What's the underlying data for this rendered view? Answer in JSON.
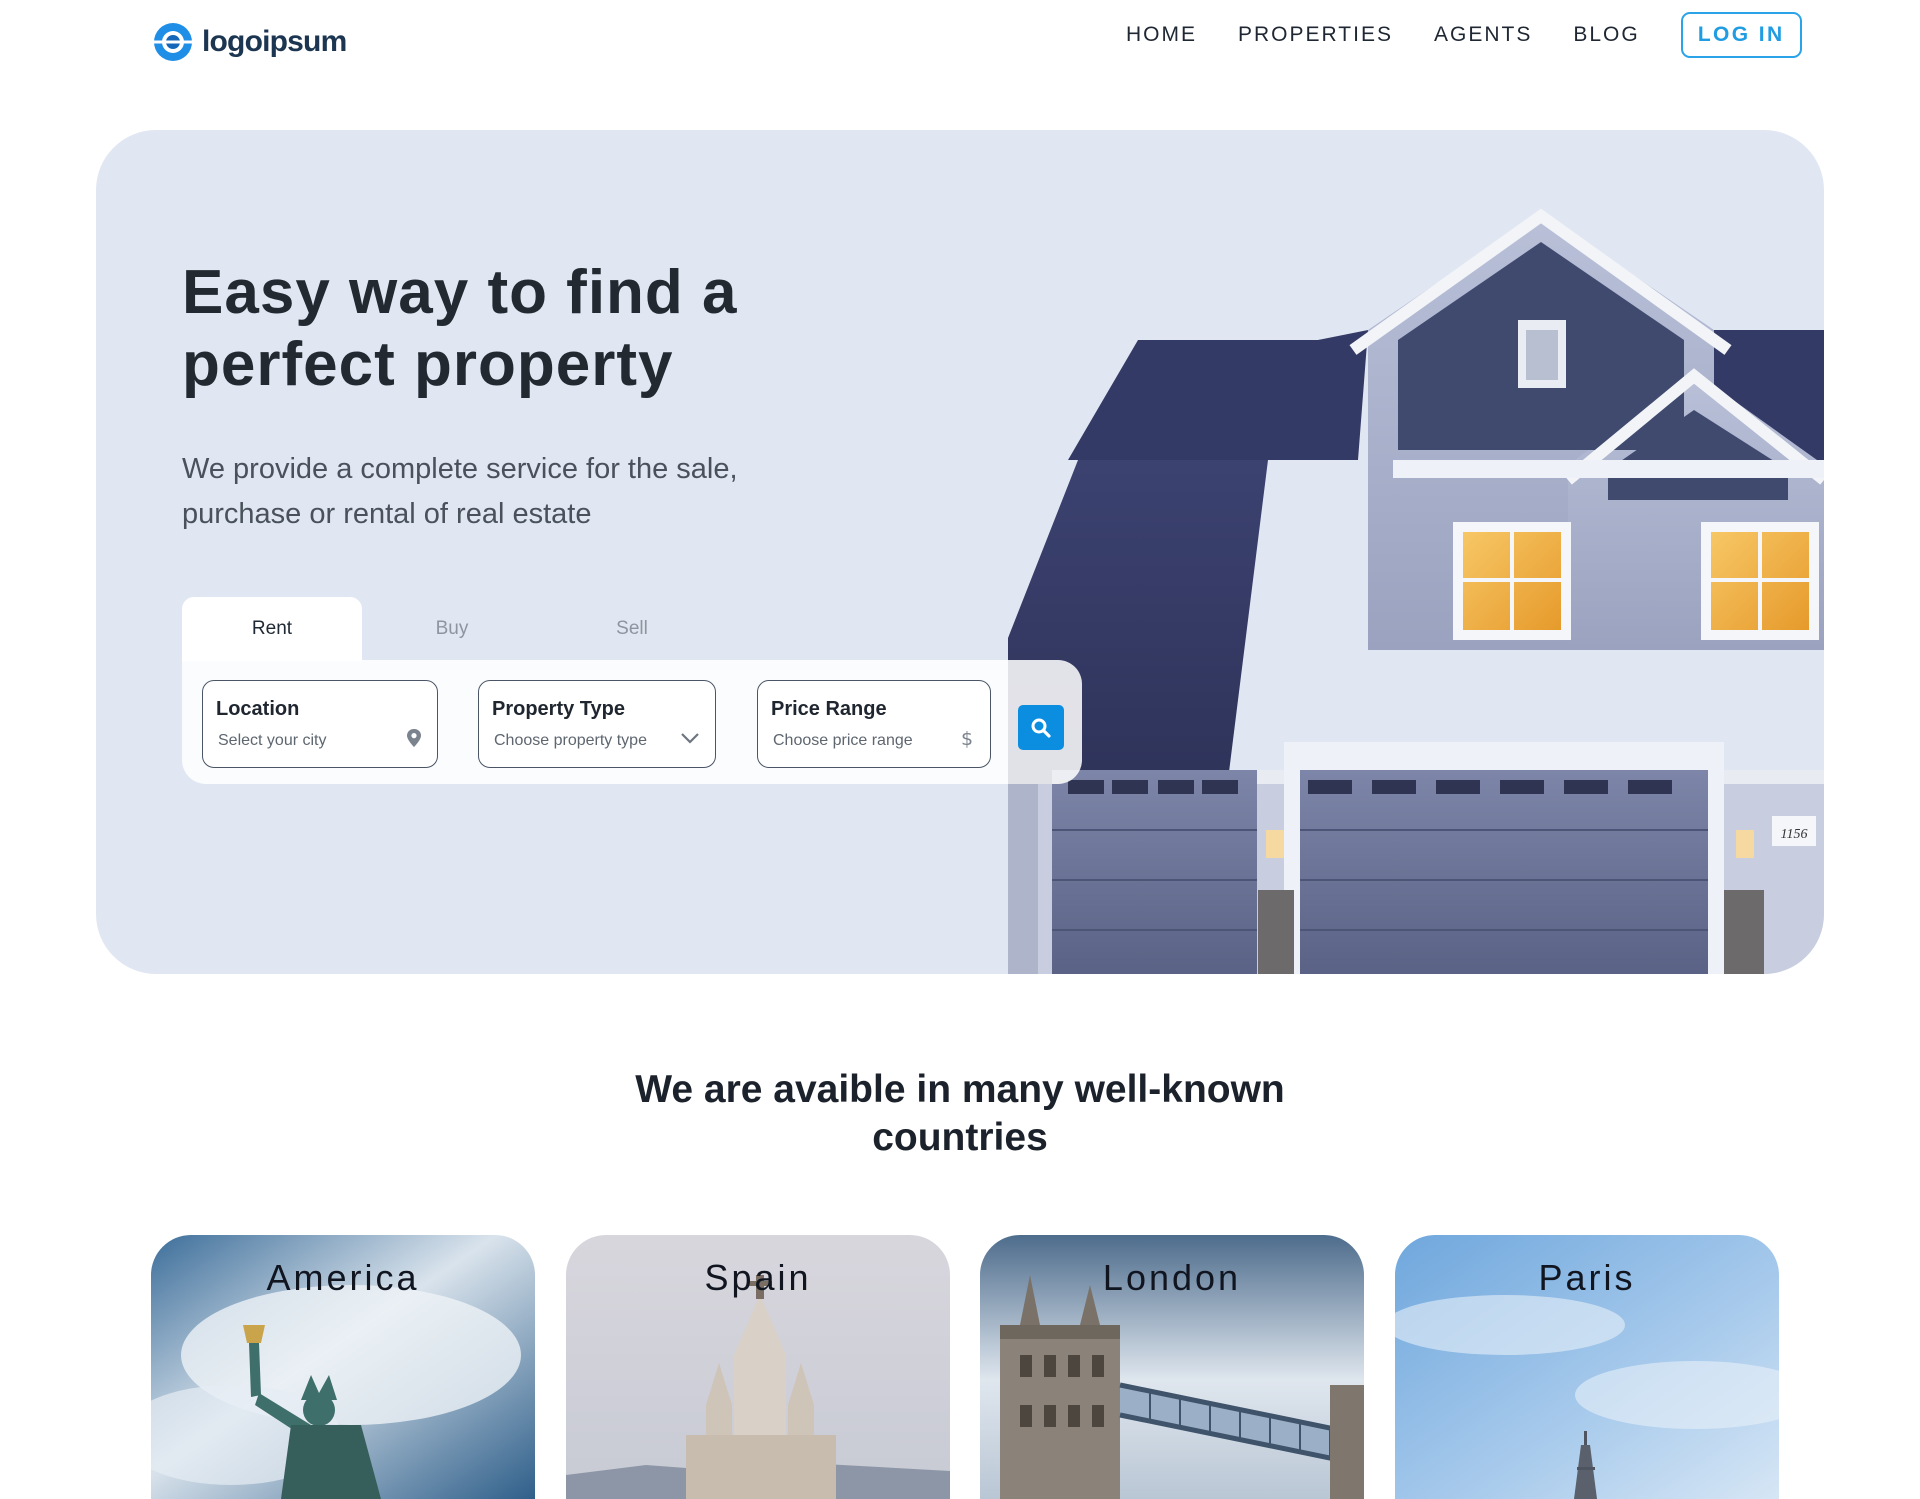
{
  "brand": {
    "name": "logoipsum",
    "accent": "#2a9ff0"
  },
  "nav": {
    "items": [
      {
        "label": "HOME"
      },
      {
        "label": "PROPERTIES"
      },
      {
        "label": "AGENTS"
      },
      {
        "label": "BLOG"
      }
    ],
    "login_label": "LOG IN"
  },
  "hero": {
    "title": "Easy way to find a perfect property",
    "subtitle": "We provide a complete service for the sale, purchase or rental of real estate",
    "house_number": "1156"
  },
  "search": {
    "tabs": [
      {
        "label": "Rent",
        "active": true
      },
      {
        "label": "Buy",
        "active": false
      },
      {
        "label": "Sell",
        "active": false
      }
    ],
    "fields": {
      "location": {
        "label": "Location",
        "placeholder": "Select your city",
        "icon": "map-pin-icon"
      },
      "property_type": {
        "label": "Property Type",
        "placeholder": "Choose property type",
        "icon": "chevron-down-icon"
      },
      "price_range": {
        "label": "Price Range",
        "placeholder": "Choose price range",
        "icon": "dollar-icon"
      }
    },
    "button_icon": "search-icon",
    "button_color": "#0b8de0"
  },
  "countries": {
    "title": "We are avaible in many well-known countries",
    "items": [
      {
        "name": "America"
      },
      {
        "name": "Spain"
      },
      {
        "name": "London"
      },
      {
        "name": "Paris"
      }
    ]
  }
}
